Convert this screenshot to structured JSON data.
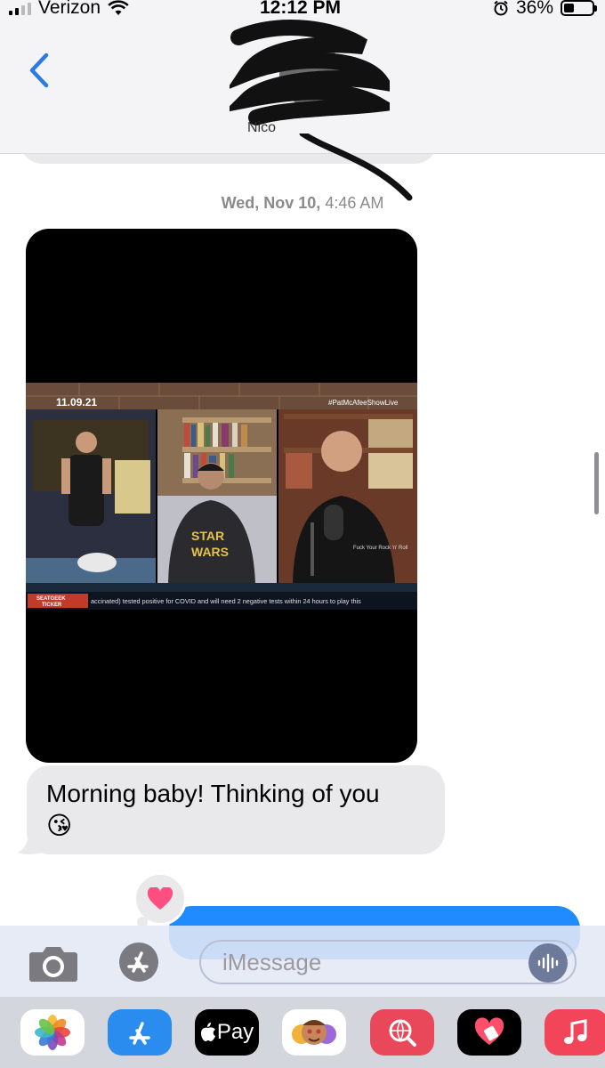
{
  "status_bar": {
    "carrier": "Verizon",
    "time": "12:12 PM",
    "battery_percent": "36%",
    "battery_level": 0.36,
    "signal_bars": 2
  },
  "header": {
    "contact_name": "Nico",
    "back_icon": "chevron-left-icon"
  },
  "conversation": {
    "timestamp_day": "Wed, Nov 10,",
    "timestamp_time": "4:46 AM",
    "video_overlay": {
      "date": "11.09.21",
      "hashtag": "#PatMcAfeeShowLive",
      "ticker_brand_top": "SEATGEEK",
      "ticker_brand_bottom": "TICKER",
      "ticker_text": "accinated) tested positive for COVID and will need 2 negative tests within 24 hours to play this",
      "shirt_text_1": "STAR",
      "shirt_text_2": "WARS",
      "shirt_text_3": "Fuck Your Rock 'n' Roll"
    },
    "received_message": "Morning baby! Thinking of you",
    "received_emoji": "😘",
    "reaction": "heart"
  },
  "input_bar": {
    "placeholder": "iMessage"
  },
  "app_drawer": {
    "items": [
      "photos-app-icon",
      "app-store-icon",
      "apple-pay-icon",
      "memoji-icon",
      "image-search-icon",
      "digital-touch-icon",
      "music-icon"
    ],
    "apple_pay_label": "Pay"
  },
  "colors": {
    "sent_bubble": "#1f8bff",
    "received_bubble": "#e9e9eb",
    "accent_blue": "#2c7be5",
    "reaction_heart": "#ff4f82"
  }
}
